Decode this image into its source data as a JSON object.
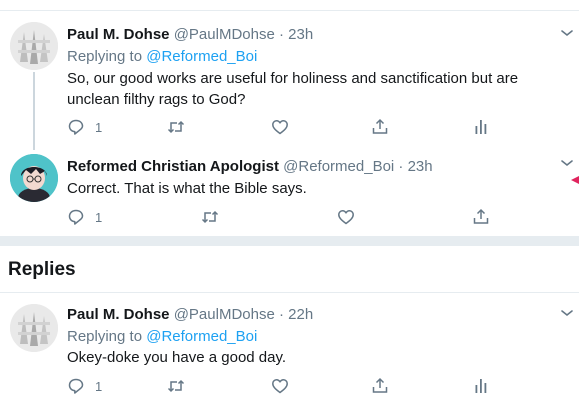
{
  "tweets": [
    {
      "name": "Paul M. Dohse",
      "handle": "@PaulMDohse",
      "time": "23h",
      "replying_prefix": "Replying to",
      "replying_to": "@Reformed_Boi",
      "text": "So, our good works are useful for holiness and sanctification but are unclean filthy rags to God?",
      "reply_count": "1"
    },
    {
      "name": "Reformed Christian Apologist",
      "handle": "@Reformed_Boi",
      "time": "23h",
      "text": "Correct. That is what the Bible says.",
      "reply_count": "1"
    }
  ],
  "replies_heading": "Replies",
  "replies": [
    {
      "name": "Paul M. Dohse",
      "handle": "@PaulMDohse",
      "time": "22h",
      "replying_prefix": "Replying to",
      "replying_to": "@Reformed_Boi",
      "text": "Okey-doke you have a good day.",
      "reply_count": "1"
    }
  ],
  "separator": "·",
  "colors": {
    "link": "#1da1f2",
    "muted": "#657786",
    "divider": "#e6ecf0"
  },
  "icons": [
    "reply-icon",
    "retweet-icon",
    "like-icon",
    "share-icon",
    "analytics-icon",
    "chevron-down-icon"
  ]
}
